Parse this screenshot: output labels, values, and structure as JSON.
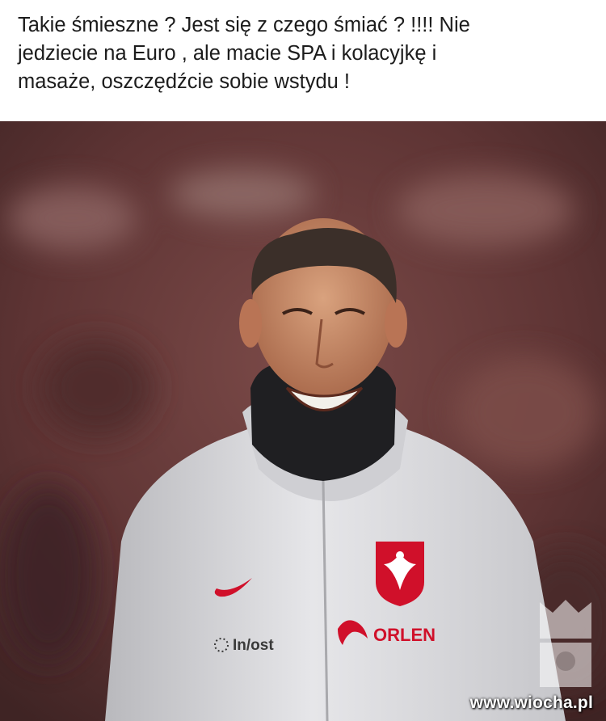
{
  "caption": {
    "lines": [
      "Takie śmieszne ? Jest się z czego śmiać ? !!!! Nie",
      "jedziecie na Euro , ale macie SPA i kolacyjkę i",
      "masaże, oszczędźcie sobie wstydu !"
    ]
  },
  "jacket": {
    "sponsor_1": "ORLEN",
    "sponsor_2": "In/ost"
  },
  "watermark": {
    "site": "www.wiocha.pl"
  },
  "colors": {
    "background_blur": "#6e3a3a",
    "jacket": "#d9d9dc",
    "accent_red": "#d0102a"
  }
}
